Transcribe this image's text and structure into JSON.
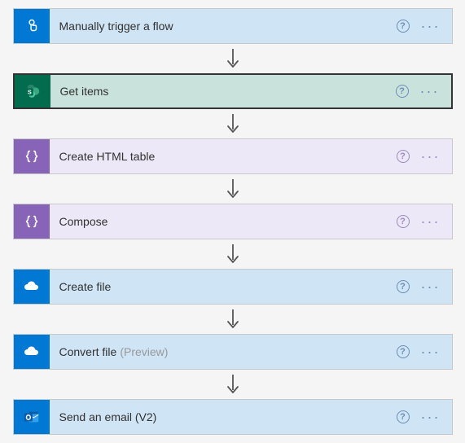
{
  "steps": [
    {
      "label": "Manually trigger a flow",
      "suffix": "",
      "theme": "lightblue",
      "iconBg": "ico-blue",
      "icon": "touch",
      "helpClass": "",
      "dotsClass": "",
      "selected": false
    },
    {
      "label": "Get items",
      "suffix": "",
      "theme": "teal",
      "iconBg": "ico-teal",
      "icon": "sharepoint",
      "helpClass": "",
      "dotsClass": "",
      "selected": true
    },
    {
      "label": "Create HTML table",
      "suffix": "",
      "theme": "lilac",
      "iconBg": "ico-purple",
      "icon": "braces",
      "helpClass": "purple",
      "dotsClass": "purple",
      "selected": false
    },
    {
      "label": "Compose",
      "suffix": "",
      "theme": "lilac",
      "iconBg": "ico-purple",
      "icon": "braces",
      "helpClass": "purple",
      "dotsClass": "purple",
      "selected": false
    },
    {
      "label": "Create file",
      "suffix": "",
      "theme": "lightblue",
      "iconBg": "ico-blue",
      "icon": "onedrive",
      "helpClass": "",
      "dotsClass": "",
      "selected": false
    },
    {
      "label": "Convert file",
      "suffix": "(Preview)",
      "theme": "lightblue",
      "iconBg": "ico-blue",
      "icon": "onedrive",
      "helpClass": "",
      "dotsClass": "",
      "selected": false
    },
    {
      "label": "Send an email (V2)",
      "suffix": "",
      "theme": "lightblue",
      "iconBg": "ico-outlook",
      "icon": "outlook",
      "helpClass": "",
      "dotsClass": "",
      "selected": false
    }
  ]
}
